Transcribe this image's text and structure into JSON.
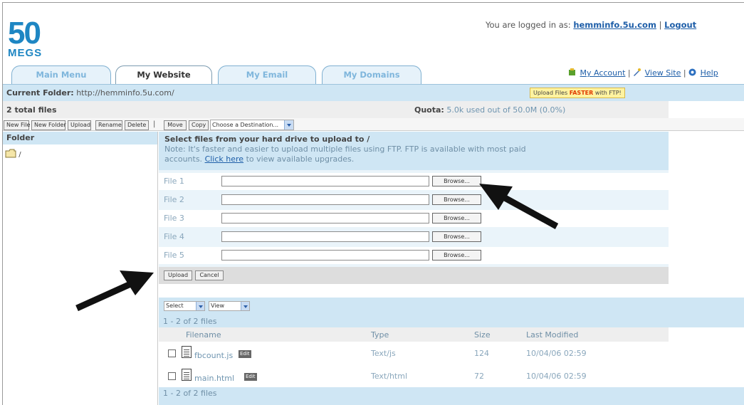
{
  "brand": {
    "logo_number": "50",
    "logo_word": "MEGS"
  },
  "header": {
    "login_prefix": "You are logged in as:",
    "username": "hemminfo.5u.com",
    "separator": "|",
    "logout": "Logout"
  },
  "tabs": [
    {
      "label": "Main Menu",
      "active": false
    },
    {
      "label": "My Website",
      "active": true
    },
    {
      "label": "My Email",
      "active": false
    },
    {
      "label": "My Domains",
      "active": false
    }
  ],
  "top_links": {
    "account": "My Account",
    "view_site": "View Site",
    "help": "Help",
    "sep": "|"
  },
  "folder_bar": {
    "label": "Current Folder:",
    "path": "http://hemminfo.5u.com/",
    "ftp_prefix": "Upload Files",
    "ftp_fast": "FASTER",
    "ftp_suffix": "with FTP!"
  },
  "stats": {
    "file_count": "2 total files",
    "quota_label": "Quota:",
    "quota_value": "5.0k used out of 50.0M (0.0%)"
  },
  "toolbar": {
    "new_file": "New File",
    "new_folder": "New Folder",
    "upload": "Upload",
    "rename": "Rename",
    "delete": "Delete",
    "sep": "|",
    "move": "Move",
    "copy": "Copy",
    "destination": "Choose a Destination..."
  },
  "sidebar": {
    "header": "Folder",
    "root": "/"
  },
  "upload_panel": {
    "title": "Select files from your hard drive to upload to /",
    "note_1": "Note: It's faster and easier to upload multiple files using FTP. FTP is available with most paid",
    "note_2_prefix": "accounts.",
    "note_link": "Click here",
    "note_2_suffix": "to view available upgrades.",
    "rows": [
      {
        "label": "File 1",
        "browse": "Browse..."
      },
      {
        "label": "File 2",
        "browse": "Browse..."
      },
      {
        "label": "File 3",
        "browse": "Browse..."
      },
      {
        "label": "File 4",
        "browse": "Browse..."
      },
      {
        "label": "File 5",
        "browse": "Browse..."
      }
    ],
    "upload_button": "Upload",
    "cancel_button": "Cancel"
  },
  "file_list": {
    "select_label": "Select",
    "view_label": "View",
    "count_top": "1 - 2 of 2 files",
    "count_bottom": "1 - 2 of 2 files",
    "columns": {
      "filename": "Filename",
      "type": "Type",
      "size": "Size",
      "modified": "Last Modified"
    },
    "edit_label": "Edit",
    "files": [
      {
        "name": "fbcount.js",
        "type": "Text/js",
        "size": "124",
        "modified": "10/04/06 02:59"
      },
      {
        "name": "main.html",
        "type": "Text/html",
        "size": "72",
        "modified": "10/04/06 02:59"
      }
    ]
  },
  "colors": {
    "brand_blue": "#1e86c3",
    "link_blue": "#1e5ea8",
    "panel_blue": "#cfe6f4",
    "arrow": "#111111"
  }
}
